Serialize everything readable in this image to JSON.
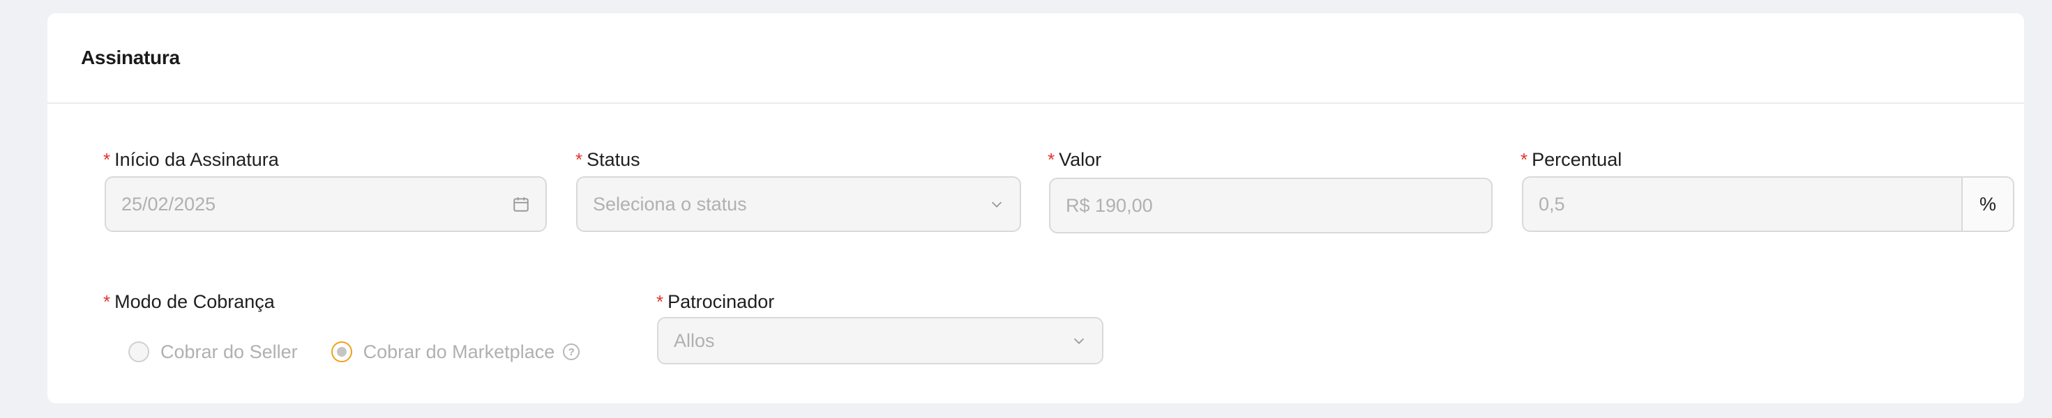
{
  "section": {
    "title": "Assinatura"
  },
  "fields": {
    "inicio": {
      "label": "Início da Assinatura",
      "value": "25/02/2025",
      "icon": "calendar-icon"
    },
    "status": {
      "label": "Status",
      "placeholder": "Seleciona o status",
      "icon": "chevron-down-icon"
    },
    "valor": {
      "label": "Valor",
      "value": "R$ 190,00"
    },
    "percentual": {
      "label": "Percentual",
      "value": "0,5",
      "suffix": "%"
    },
    "modo": {
      "label": "Modo de Cobrança",
      "options": [
        {
          "label": "Cobrar do Seller",
          "selected": false
        },
        {
          "label": "Cobrar do Marketplace",
          "selected": true,
          "help": "?"
        }
      ]
    },
    "patrocinador": {
      "label": "Patrocinador",
      "value": "Allos",
      "icon": "chevron-down-icon"
    }
  },
  "required_mark": "*",
  "colors": {
    "required": "#e0342c",
    "radio_selected": "#f0a21a",
    "disabled_bg": "#f5f5f5"
  }
}
